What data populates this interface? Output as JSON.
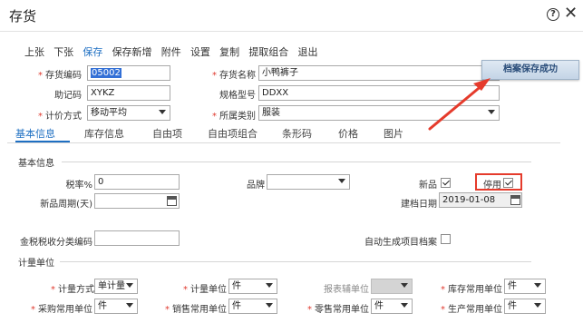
{
  "window": {
    "title": "存货"
  },
  "toolbar": {
    "items": [
      {
        "label": "上张",
        "active": false
      },
      {
        "label": "下张",
        "active": false
      },
      {
        "label": "保存",
        "active": true
      },
      {
        "label": "保存新增",
        "active": false
      },
      {
        "label": "附件",
        "active": false
      },
      {
        "label": "设置",
        "active": false
      },
      {
        "label": "复制",
        "active": false
      },
      {
        "label": "提取组合",
        "active": false
      },
      {
        "label": "退出",
        "active": false
      }
    ]
  },
  "header_form": {
    "code_label": "存货编码",
    "code_value": "05002",
    "name_label": "存货名称",
    "name_value": "小鸭裤子",
    "mnemonic_label": "助记码",
    "mnemonic_value": "XYKZ",
    "spec_label": "规格型号",
    "spec_value": "DDXX",
    "pricing_label": "计价方式",
    "pricing_value": "移动平均",
    "category_label": "所属类别",
    "category_value": "服装"
  },
  "toast": {
    "message": "档案保存成功"
  },
  "tabs": [
    {
      "label": "基本信息",
      "active": true
    },
    {
      "label": "库存信息",
      "active": false
    },
    {
      "label": "自由项",
      "active": false
    },
    {
      "label": "自由项组合",
      "active": false
    },
    {
      "label": "条形码",
      "active": false
    },
    {
      "label": "价格",
      "active": false
    },
    {
      "label": "图片",
      "active": false
    }
  ],
  "basic": {
    "section_title": "基本信息",
    "tax_label": "税率%",
    "tax_value": "0",
    "brand_label": "品牌",
    "brand_value": "",
    "new_label": "新品",
    "new_checked": true,
    "disabled_label": "停用",
    "disabled_checked": true,
    "newcycle_label": "新品周期(天)",
    "newcycle_value": "",
    "created_label": "建档日期",
    "created_value": "2019-01-08",
    "taxcode_label": "金税税收分类编码",
    "taxcode_value": "",
    "autogen_label": "自动生成项目档案",
    "autogen_checked": false
  },
  "units": {
    "section_title": "计量单位",
    "method_label": "计量方式",
    "method_value": "单计量",
    "unit_label": "计量单位",
    "unit_value": "件",
    "report_label": "报表辅单位",
    "report_value": "",
    "stock_label": "库存常用单位",
    "stock_value": "件",
    "purchase_label": "采购常用单位",
    "purchase_value": "件",
    "sales_label": "销售常用单位",
    "sales_value": "件",
    "retail_label": "零售常用单位",
    "retail_value": "件",
    "production_label": "生产常用单位",
    "production_value": "件"
  },
  "colors": {
    "accent": "#1e6fc2",
    "required": "#e03a2f",
    "highlight": "#e53b2c"
  }
}
